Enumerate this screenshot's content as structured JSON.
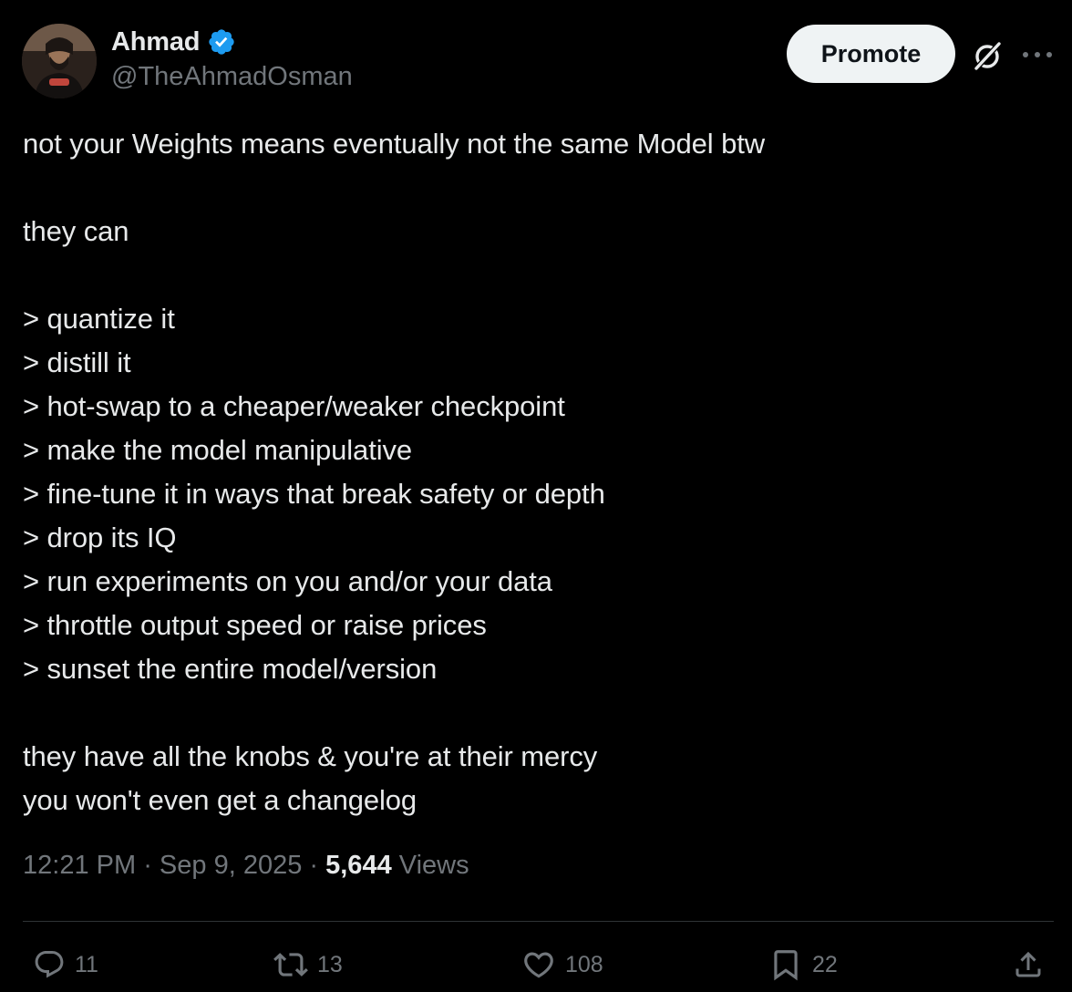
{
  "author": {
    "display_name": "Ahmad",
    "handle": "@TheAhmadOsman",
    "verified": true
  },
  "header": {
    "promote_label": "Promote",
    "icons": [
      "verified-badge-icon",
      "grok-icon",
      "more-icon"
    ]
  },
  "tweet": {
    "lines": [
      "not your Weights means eventually not the same Model btw",
      "",
      "they can",
      "",
      "> quantize it",
      "> distill it",
      "> hot-swap to a cheaper/weaker checkpoint",
      "> make the model manipulative",
      "> fine-tune it in ways that break safety or depth",
      "> drop its IQ",
      "> run experiments on you and/or your data",
      "> throttle output speed or raise prices",
      "> sunset the entire model/version",
      "",
      "they have all the knobs & you're at their mercy",
      "you won't even get a changelog"
    ]
  },
  "meta": {
    "time": "12:21 PM",
    "date": "Sep 9, 2025",
    "separator": " · ",
    "views_count": "5,644",
    "views_label": " Views"
  },
  "actions": {
    "reply_count": "11",
    "retweet_count": "13",
    "like_count": "108",
    "bookmark_count": "22"
  },
  "colors": {
    "background": "#000000",
    "text": "#e7e9ea",
    "secondary": "#71767b",
    "verified": "#1d9bf0",
    "promote_bg": "#eff3f4"
  }
}
